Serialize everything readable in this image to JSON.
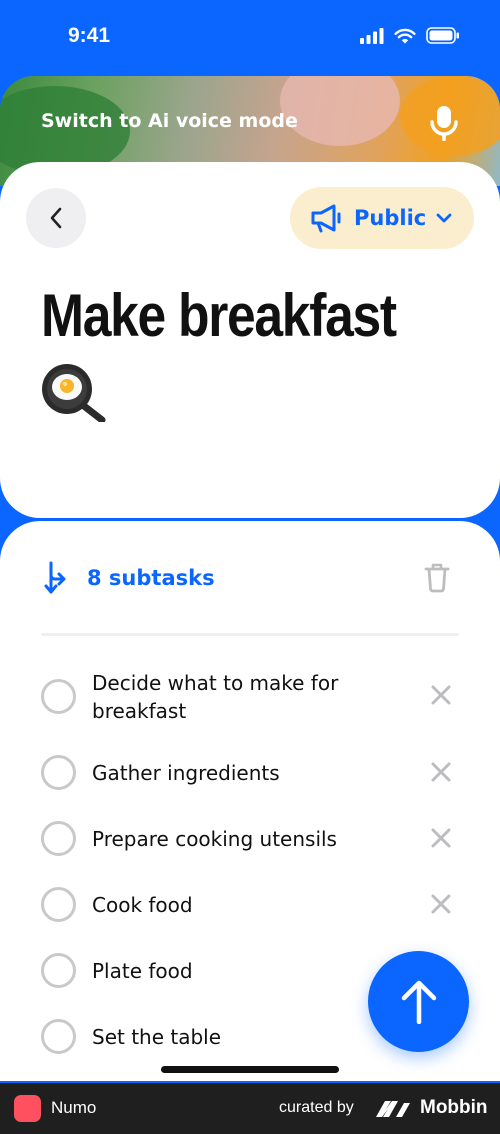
{
  "status_bar": {
    "time": "9:41"
  },
  "banner": {
    "label": "Switch to Ai voice mode"
  },
  "header": {
    "visibility_label": "Public"
  },
  "task": {
    "title": "Make breakfast"
  },
  "subtasks": {
    "count_label": "8 subtasks",
    "items": [
      {
        "label": "Decide what to make for breakfast"
      },
      {
        "label": "Gather ingredients"
      },
      {
        "label": "Prepare cooking utensils"
      },
      {
        "label": "Cook food"
      },
      {
        "label": "Plate food"
      },
      {
        "label": "Set the table"
      }
    ]
  },
  "footer": {
    "app_name": "Numo",
    "curated_label": "curated by",
    "brand": "Mobbin"
  },
  "colors": {
    "accent": "#0a66ff",
    "pill_bg": "#fbeecf",
    "muted": "#c9c9cc"
  }
}
